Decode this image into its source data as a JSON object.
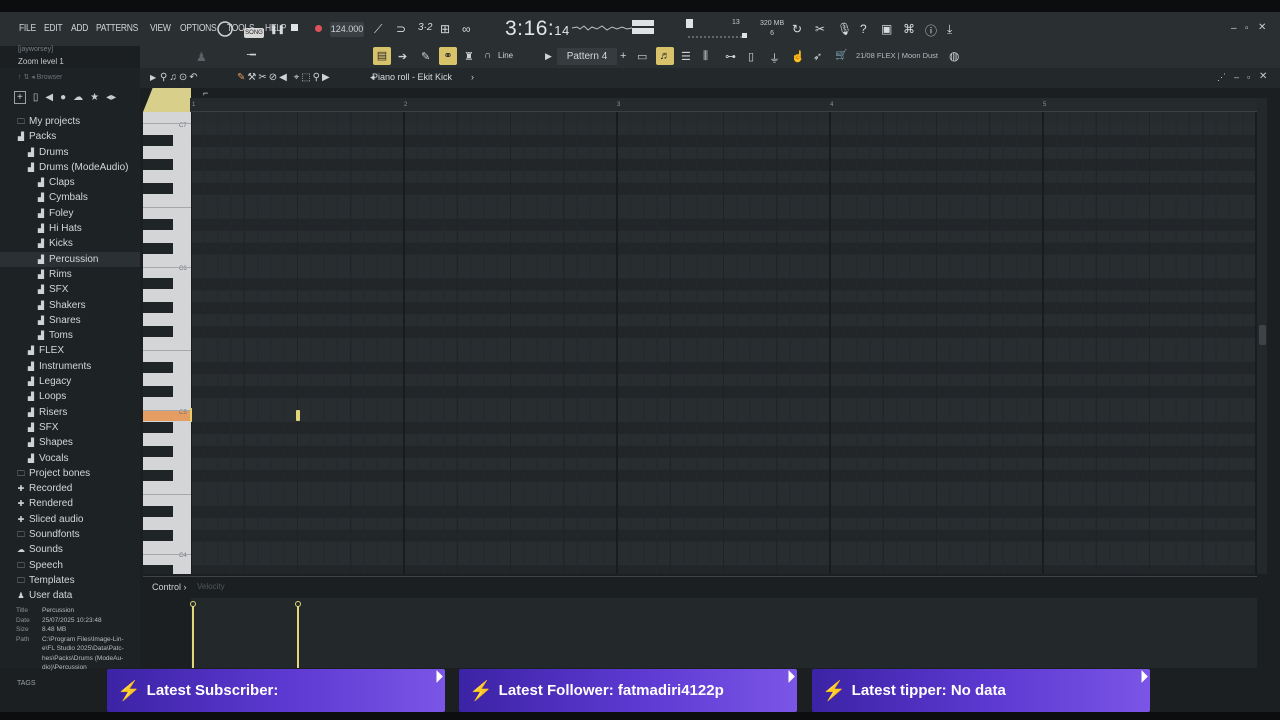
{
  "menu": [
    "FILE",
    "EDIT",
    "ADD",
    "PATTERNS",
    "VIEW",
    "OPTIONS",
    "TOOLS",
    "HELP"
  ],
  "hint_user": "[jayworsey]",
  "hint_zoom": "Zoom level 1",
  "song_mode": "SONG",
  "tempo": "124.000",
  "time_main": "3:16:",
  "time_small": "14",
  "cpu": "13",
  "mem_top": "320 MB",
  "mem_bottom": "6",
  "pattern": "Pattern 4",
  "line_tool": "Line",
  "hint_bar": "21/08  FLEX | Moon Dust",
  "browser_label": "Browser",
  "piano_roll_title": "Piano roll - Ekit Kick",
  "ruler_marks": [
    "1",
    "2",
    "3",
    "4",
    "5"
  ],
  "octaves": [
    "C7",
    "C6",
    "C5",
    "C4"
  ],
  "tree": [
    {
      "label": "My projects",
      "icon": "folder-icon",
      "level": 0
    },
    {
      "label": "Packs",
      "icon": "pack-folder-icon",
      "level": 0
    },
    {
      "label": "Drums",
      "icon": "pack-folder-icon",
      "level": 1
    },
    {
      "label": "Drums (ModeAudio)",
      "icon": "pack-folder-icon",
      "level": 1
    },
    {
      "label": "Claps",
      "icon": "pack-folder-icon",
      "level": 2
    },
    {
      "label": "Cymbals",
      "icon": "pack-folder-icon",
      "level": 2
    },
    {
      "label": "Foley",
      "icon": "pack-folder-icon",
      "level": 2
    },
    {
      "label": "Hi Hats",
      "icon": "pack-folder-icon",
      "level": 2
    },
    {
      "label": "Kicks",
      "icon": "pack-folder-icon",
      "level": 2
    },
    {
      "label": "Percussion",
      "icon": "pack-folder-icon",
      "level": 2,
      "selected": true
    },
    {
      "label": "Rims",
      "icon": "pack-folder-icon",
      "level": 2
    },
    {
      "label": "SFX",
      "icon": "pack-folder-icon",
      "level": 2
    },
    {
      "label": "Shakers",
      "icon": "pack-folder-icon",
      "level": 2
    },
    {
      "label": "Snares",
      "icon": "pack-folder-icon",
      "level": 2
    },
    {
      "label": "Toms",
      "icon": "pack-folder-icon",
      "level": 2
    },
    {
      "label": "FLEX",
      "icon": "pack-folder-icon",
      "level": 1
    },
    {
      "label": "Instruments",
      "icon": "pack-folder-icon",
      "level": 1
    },
    {
      "label": "Legacy",
      "icon": "pack-folder-icon",
      "level": 1
    },
    {
      "label": "Loops",
      "icon": "pack-folder-icon",
      "level": 1
    },
    {
      "label": "Risers",
      "icon": "pack-folder-icon",
      "level": 1
    },
    {
      "label": "SFX",
      "icon": "pack-folder-icon",
      "level": 1
    },
    {
      "label": "Shapes",
      "icon": "pack-folder-icon",
      "level": 1
    },
    {
      "label": "Vocals",
      "icon": "pack-folder-icon",
      "level": 1
    },
    {
      "label": "Project bones",
      "icon": "folder-icon",
      "level": 0
    },
    {
      "label": "Recorded",
      "icon": "plus-icon",
      "level": 0
    },
    {
      "label": "Rendered",
      "icon": "plus-icon",
      "level": 0
    },
    {
      "label": "Sliced audio",
      "icon": "plus-icon",
      "level": 0
    },
    {
      "label": "Soundfonts",
      "icon": "folder-icon",
      "level": 0
    },
    {
      "label": "Sounds",
      "icon": "cloud-icon",
      "level": 0
    },
    {
      "label": "Speech",
      "icon": "folder-icon",
      "level": 0
    },
    {
      "label": "Templates",
      "icon": "folder-icon",
      "level": 0
    },
    {
      "label": "User data",
      "icon": "user-icon",
      "level": 0
    }
  ],
  "meta": {
    "title_key": "Title",
    "title_val": "Percussion",
    "date_key": "Date",
    "date_val": "25/07/2025 10:23:48",
    "size_key": "Size",
    "size_val": "8.48 MB",
    "path_key": "Path",
    "path_lines": [
      "C:\\Program Files\\Image-Lin-",
      "e\\FL Studio 2025\\Data\\Patc-",
      "hes\\Packs\\Drums (ModeAu-",
      "dio)\\Percussion"
    ]
  },
  "tags_label": "TAGS",
  "control_label": "Control",
  "control_param": "Velocity",
  "overlays": [
    {
      "text": "Latest Subscriber:"
    },
    {
      "text": "Latest Follower: fatmadiri4122p"
    },
    {
      "text": "Latest tipper: No data"
    }
  ],
  "colors": {
    "accent": "#e3d67a",
    "key_highlight": "#e59d63",
    "overlay_purple": "#5e3ad3",
    "bolt": "#58c7ff"
  }
}
